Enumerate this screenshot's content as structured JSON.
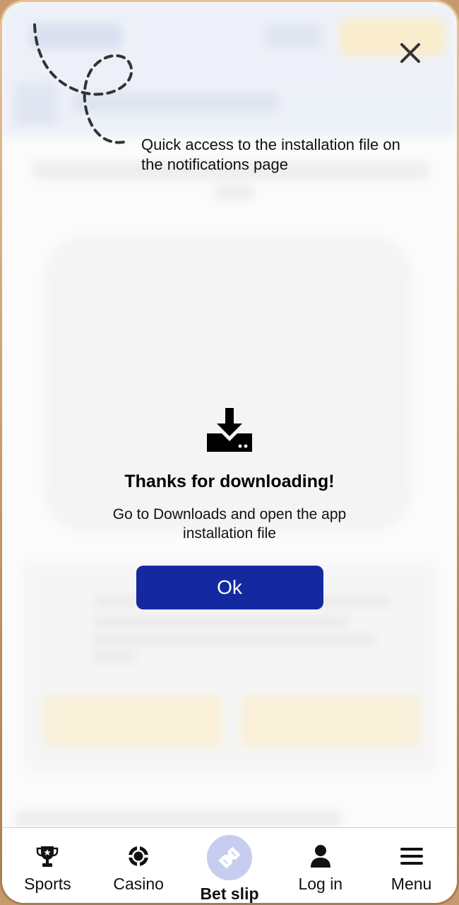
{
  "hint": {
    "text": "Quick access to the installation file on the notifications page"
  },
  "close": {
    "icon": "close-icon"
  },
  "modal": {
    "icon": "download-icon",
    "title": "Thanks for downloading!",
    "message": "Go to Downloads and open the app installation file",
    "ok_label": "Ok"
  },
  "bottom_nav": {
    "items": [
      {
        "label": "Sports",
        "icon": "trophy-icon",
        "active": false
      },
      {
        "label": "Casino",
        "icon": "casino-chip-icon",
        "active": false
      },
      {
        "label": "Bet slip",
        "icon": "ticket-icon",
        "active": true
      },
      {
        "label": "Log in",
        "icon": "user-icon",
        "active": false
      },
      {
        "label": "Menu",
        "icon": "hamburger-menu-icon",
        "active": false
      }
    ]
  },
  "colors": {
    "primary_button": "#1429a0",
    "active_nav_bg": "#c7cdee",
    "frame": "#c69a6a"
  }
}
